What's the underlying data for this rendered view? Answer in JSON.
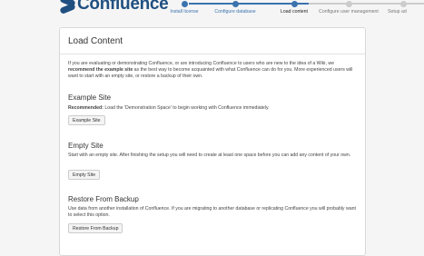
{
  "logo": {
    "text": "Confluence"
  },
  "steps": [
    {
      "label": "Install license",
      "state": "done"
    },
    {
      "label": "Configure database",
      "state": "done"
    },
    {
      "label": "Load content",
      "state": "current"
    },
    {
      "label": "Configure user management",
      "state": "future"
    },
    {
      "label": "Setup ad",
      "state": "future"
    }
  ],
  "panel": {
    "title": "Load Content",
    "intro_pre": "If you are evaluating or demonstrating Confluence, or are introducing Confluence to users who are new to the idea of a Wiki, we ",
    "intro_bold": "recommend the example site",
    "intro_post": " as the best way to become acquainted with what Confluence can do for you. More experienced users will want to start with an empty site, or restore a backup of their own.",
    "example": {
      "heading": "Example Site",
      "desc_bold": "Recommended:",
      "desc": " Load the 'Demonstration Space' to begin working with Confluence immediately.",
      "button": "Example Site"
    },
    "empty": {
      "heading": "Empty Site",
      "desc": "Start with an empty site. After finishing the setup you will need to create at least one space before you can add any content of your own.",
      "button": "Empty Site"
    },
    "restore": {
      "heading": "Restore From Backup",
      "desc": "Use data from another installation of Confluence. If you are migrating to another database or replicating Confluence you will probably want to select this option.",
      "button": "Restore From Backup"
    }
  }
}
